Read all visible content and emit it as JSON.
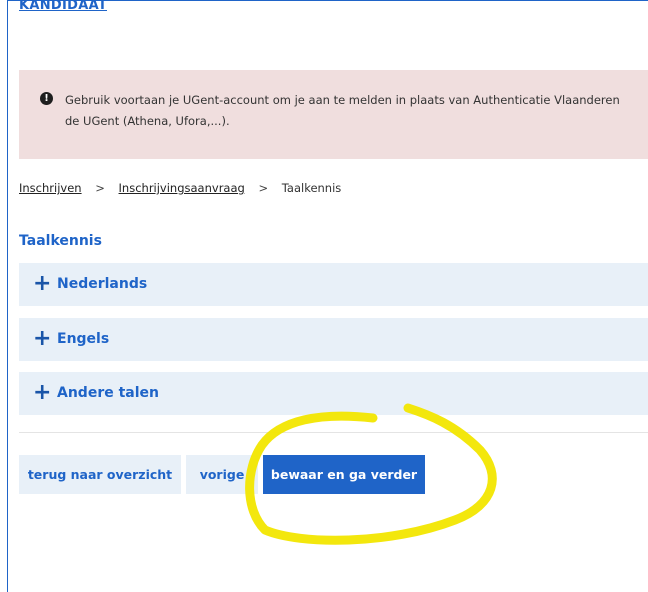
{
  "header": {
    "title": "KANDIDAAT"
  },
  "alert": {
    "icon": "exclamation-circle-icon",
    "text": "Gebruik voortaan je UGent-account om je aan te melden in plaats van Authenticatie Vlaanderen\nde UGent (Athena, Ufora,...)."
  },
  "breadcrumb": {
    "items": [
      "Inschrijven",
      "Inschrijvingsaanvraag",
      "Taalkennis"
    ],
    "separator": ">"
  },
  "section": {
    "title": "Taalkennis"
  },
  "accordion": [
    {
      "label": "Nederlands",
      "icon": "plus-icon"
    },
    {
      "label": "Engels",
      "icon": "plus-icon"
    },
    {
      "label": "Andere talen",
      "icon": "plus-icon"
    }
  ],
  "buttons": {
    "overview": "terug naar overzicht",
    "previous": "vorige",
    "save_continue": "bewaar en ga verder"
  },
  "colors": {
    "accent": "#1f64c8",
    "alert_bg": "#f0dede",
    "accordion_bg": "#e8f0f8",
    "annotation": "#f2e600"
  }
}
